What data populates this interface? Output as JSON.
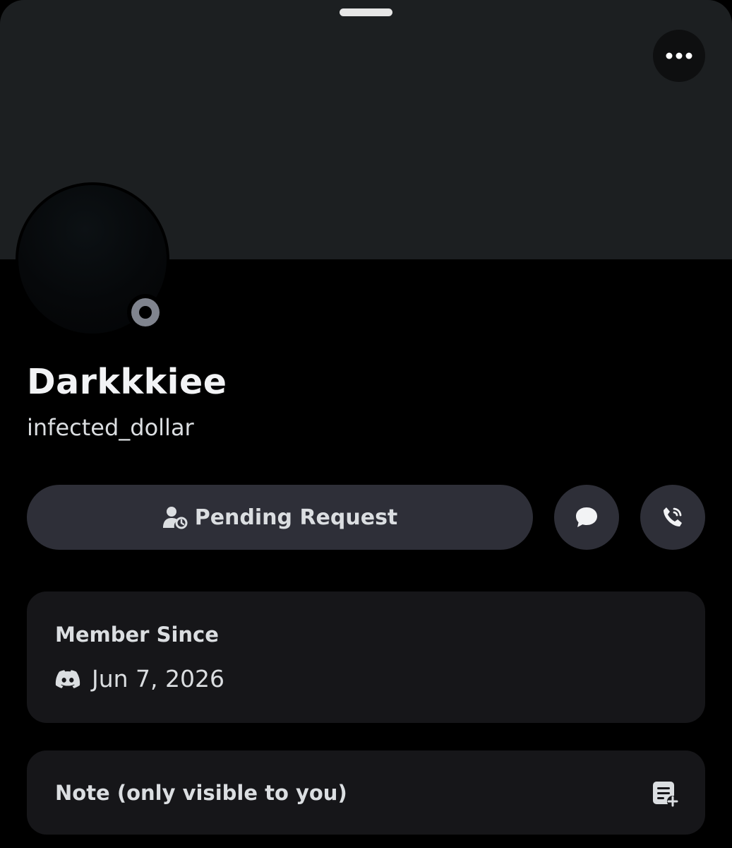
{
  "profile": {
    "display_name": "Darkkkiee",
    "username": "infected_dollar",
    "status": "offline"
  },
  "actions": {
    "pending_label": "Pending Request",
    "message_icon": "chat-bubble-icon",
    "call_icon": "phone-call-icon",
    "more_icon": "more-horizontal-icon"
  },
  "member_since": {
    "title": "Member Since",
    "icon": "discord-logo-icon",
    "date": "Jun 7, 2026"
  },
  "note": {
    "title": "Note (only visible to you)",
    "icon": "add-note-icon"
  },
  "colors": {
    "banner": "#1c1f21",
    "button_bg": "#2e2f38",
    "card_bg": "#161619",
    "status_offline": "#80848e"
  }
}
